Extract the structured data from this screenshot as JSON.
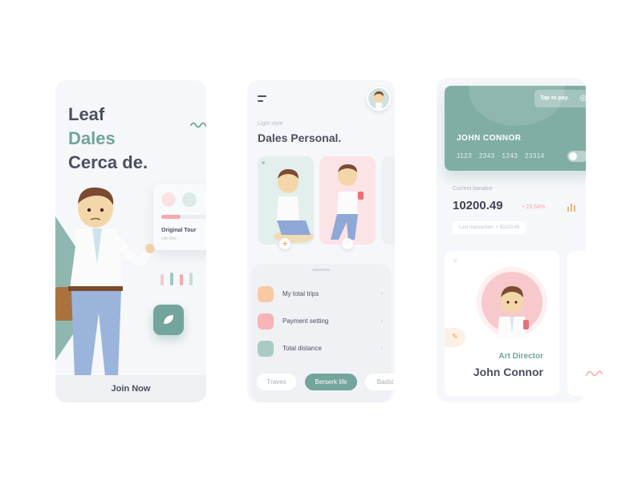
{
  "screen1": {
    "headline": [
      "Leaf",
      "Dales",
      "Cerca de."
    ],
    "tour_card": {
      "title": "Original Tour",
      "subtitle": "Life One",
      "progress": 0.32
    },
    "join_label": "Join Now",
    "icons": [
      "wave-icon",
      "leaf-icon"
    ],
    "colors": {
      "accent": "#6fa59a",
      "pink": "#f3a8ac"
    }
  },
  "screen2": {
    "light_label": "Light style",
    "title": "Dales Personal.",
    "menu": [
      {
        "label": "My total trips",
        "icon": "trips-icon",
        "color": "#f9c9a4"
      },
      {
        "label": "Payment setting",
        "icon": "payment-icon",
        "color": "#f6b4b6"
      },
      {
        "label": "Total distance",
        "icon": "distance-icon",
        "color": "#a9cbc4"
      }
    ],
    "chips": [
      {
        "label": "Traves",
        "active": false
      },
      {
        "label": "Berserk life",
        "active": true
      },
      {
        "label": "Badst",
        "active": false
      }
    ]
  },
  "screen3": {
    "card": {
      "tap_label": "Tap to pay.",
      "holder": "JOHN CONNOR",
      "number": "1123  2343  1243  23314"
    },
    "balance_label": "Current banalce",
    "balance": "10200.49",
    "change": "• 23.54%",
    "last_transaction": "Last transaction: + $1100.49",
    "profile": {
      "role": "Art Director",
      "name": "John Connor"
    }
  }
}
